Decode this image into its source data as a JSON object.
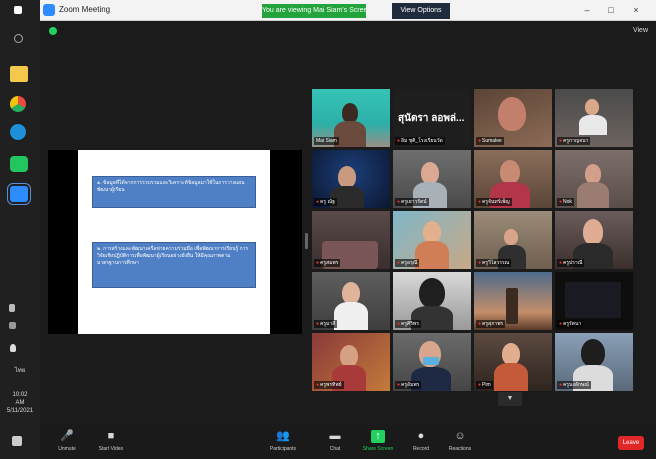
{
  "window": {
    "title": "Zoom Meeting",
    "share_banner": "You are viewing Mai Siam's Screen",
    "view_options": "View Options",
    "minimize": "–",
    "maximize": "□",
    "close": "×",
    "view_label": "View"
  },
  "taskbar": {
    "tray_lines": [
      "10:02",
      "AM",
      "5/11/2021"
    ],
    "lang": "ไทย"
  },
  "slide": {
    "paragraph_1": "๑. ข้อมูลที่ได้จากการรวบรวมและวิเคราะห์ข้อมูลมาใช้ในการวางแผนพัฒนาผู้เรียน",
    "paragraph_2": "๒. การสร้างและพัฒนาเครือข่ายความร่วมมือ เพื่อพัฒนาการเรียนรู้ การวิจัยเชิงปฏิบัติการเพื่อพัฒนาผู้เรียนอย่างยั่งยืน ให้มีคุณภาพตามมาตรฐานการศึกษา"
  },
  "participants": [
    {
      "name": "Mai Siam",
      "active": true,
      "video_text": ""
    },
    {
      "name": "อิ่ม ชุติ_โรงเรียนวัด",
      "active": false,
      "video_text": "สุนัตรา ลอพล่..."
    },
    {
      "name": "Sumalee",
      "active": false,
      "video_text": ""
    },
    {
      "name": "ครูกาญจนา",
      "active": false,
      "video_text": ""
    },
    {
      "name": "ครู ณัฐ",
      "active": false,
      "video_text": ""
    },
    {
      "name": "ครูเยาวรัตน์",
      "active": false,
      "video_text": ""
    },
    {
      "name": "ครูจันทร์เพ็ญ",
      "active": false,
      "video_text": ""
    },
    {
      "name": "Nok",
      "active": false,
      "video_text": ""
    },
    {
      "name": "ครูสมพร",
      "active": false,
      "video_text": ""
    },
    {
      "name": "ครูอรุณี",
      "active": false,
      "video_text": ""
    },
    {
      "name": "ครูวิไลวรรณ",
      "active": false,
      "video_text": ""
    },
    {
      "name": "ครูปราณี",
      "active": false,
      "video_text": ""
    },
    {
      "name": "ครูมาลี",
      "active": false,
      "video_text": ""
    },
    {
      "name": "ครูศิริพร",
      "active": false,
      "video_text": ""
    },
    {
      "name": "ครูสุภาพร",
      "active": false,
      "video_text": ""
    },
    {
      "name": "ครูรัตนา",
      "active": false,
      "video_text": ""
    },
    {
      "name": "ครูพรทิพย์",
      "active": false,
      "video_text": ""
    },
    {
      "name": "ครูอัมพร",
      "active": false,
      "video_text": ""
    },
    {
      "name": "Pim",
      "active": false,
      "video_text": ""
    },
    {
      "name": "ครูนงลักษณ์",
      "active": false,
      "video_text": ""
    }
  ],
  "toolbar": {
    "mute": "Unmute",
    "video": "Start Video",
    "participants": "Participants",
    "participants_count": "20",
    "chat": "Chat",
    "share": "Share Screen",
    "record": "Record",
    "reactions": "Reactions",
    "leave": "Leave"
  },
  "colors": {
    "accent_green": "#23d160",
    "leave_red": "#e02828",
    "active_speaker": "#d8e23a",
    "slide_box": "#4f7fc4"
  }
}
